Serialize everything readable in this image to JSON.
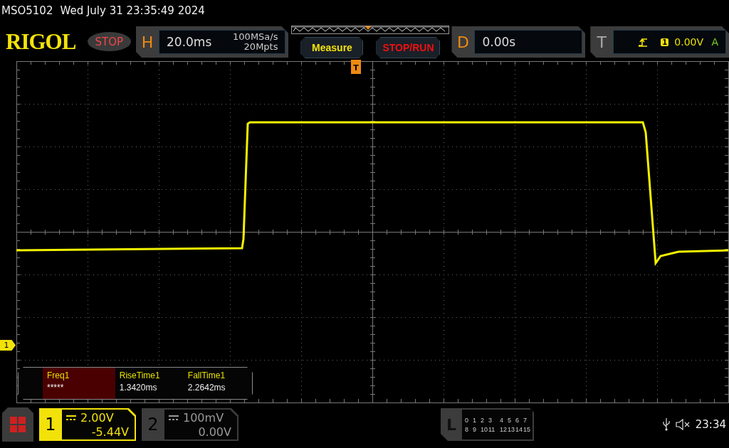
{
  "status_line": {
    "model": "MSO5102",
    "datetime": "Wed July 31 23:35:49 2024"
  },
  "toolbar": {
    "logo": "RIGOL",
    "run_state": "STOP",
    "horizontal": {
      "label": "H",
      "timebase": "20.0ms",
      "sample_rate": "100MSa/s",
      "memory_depth": "20Mpts"
    },
    "buttons": [
      {
        "label": "Measure",
        "kind": "measure"
      },
      {
        "label": "STOP/RUN",
        "kind": "stoprun"
      }
    ],
    "delay": {
      "label": "D",
      "value": "0.00s"
    },
    "trigger": {
      "label": "T",
      "source": "1",
      "level": "0.00V",
      "mode": "A"
    }
  },
  "screen": {
    "trigger_marker": "T",
    "channel_marker": "1"
  },
  "measurements": [
    {
      "name": "Freq1",
      "value": "*****",
      "selected": true
    },
    {
      "name": "RiseTime1",
      "value": "1.3420ms",
      "selected": false
    },
    {
      "name": "FallTime1",
      "value": "2.2642ms",
      "selected": false
    }
  ],
  "channels": [
    {
      "number": "1",
      "scale": "2.00V",
      "offset": "-5.44V",
      "selected": true
    },
    {
      "number": "2",
      "scale": "100mV",
      "offset": "0.00V",
      "selected": false
    }
  ],
  "logic": {
    "label": "L",
    "row_1": [
      "0",
      "1",
      "2",
      "3",
      "4",
      "5",
      "6",
      "7"
    ],
    "row_2": [
      "8",
      "9",
      "10",
      "11",
      "12",
      "13",
      "14",
      "15"
    ]
  },
  "status": {
    "time": "23:34"
  }
}
